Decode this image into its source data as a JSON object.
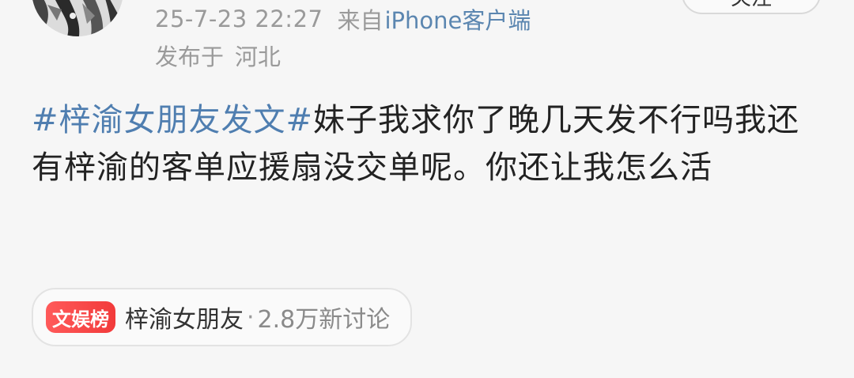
{
  "post": {
    "time": "25-7-23 22:27",
    "source_prefix": "来自",
    "source_device": "iPhone客户端",
    "location_prefix": "发布于",
    "location": "河北",
    "follow_button_label": "关注",
    "content": {
      "topic": "#梓渝女朋友发文#",
      "text": "妹子我求你了晚几天发不行吗我还有梓渝的客单应援扇没交单呢。你还让我怎么活"
    },
    "topic_card": {
      "badge": "文娱榜",
      "name": "梓渝女朋友",
      "separator": "·",
      "stat": "2.8万新讨论"
    }
  },
  "colors": {
    "link_blue": "#4f7eb0",
    "badge_red": "#f23a3a",
    "meta_gray": "#9a9a9a"
  },
  "icons": {
    "avatar": "avatar-illustration"
  }
}
